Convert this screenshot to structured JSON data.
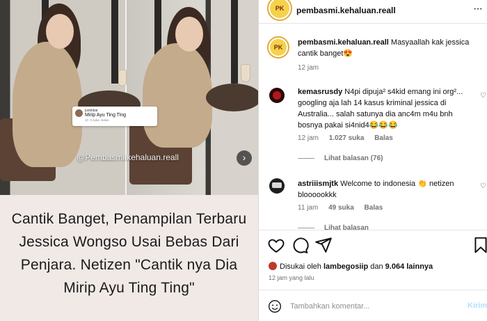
{
  "post_image": {
    "comment_snippet": {
      "user": "justinbar",
      "text": "Mirip Ayu Ting Ting",
      "time": "1h",
      "likes": "3 suka",
      "reply": "Balas"
    },
    "watermark": "@Pembasmi.kehaluan.reall",
    "headline_lines": [
      "Cantik Banget, Penampilan Terbaru",
      "Jessica Wongso Usai Bebas Dari",
      "Penjara. Netizen \"Cantik nya Dia",
      "Mirip Ayu Ting Ting\""
    ]
  },
  "header": {
    "username": "pembasmi.kehaluan.reall",
    "avatar_text": "PK"
  },
  "comments": [
    {
      "user": "pembasmi.kehaluan.reall",
      "text": "Masyaallah kak jessica cantik banget😍",
      "time": "12 jam"
    },
    {
      "user": "kemasrusdy",
      "text": "N4pi dipuja² s4kid emang ini org²... googling aja lah 14 kasus kriminal jessica di Australia... salah satunya dia anc4m m4u bnh bosnya pakai si4nid4😂😂😂",
      "time": "12 jam",
      "likes": "1.027 suka",
      "reply": "Balas",
      "view_replies": "Lihat balasan (76)"
    },
    {
      "user": "astriiismjtk",
      "text": "Welcome to indonesia 👏 netizen bloooookkk",
      "time": "11 jam",
      "likes": "49 suka",
      "reply": "Balas",
      "view_replies": "Lihat balasan"
    }
  ],
  "likes_bar": {
    "prefix": "Disukai oleh",
    "user": "lambegosiip",
    "joiner": "dan",
    "count": "9.064 lainnya",
    "timeago": "12 jam yang lalu"
  },
  "composer": {
    "placeholder": "Tambahkan komentar...",
    "post_label": "Kirim"
  },
  "colors": {
    "accent_blue_disabled": "#b2dffc",
    "ring": "#e2a93b"
  }
}
